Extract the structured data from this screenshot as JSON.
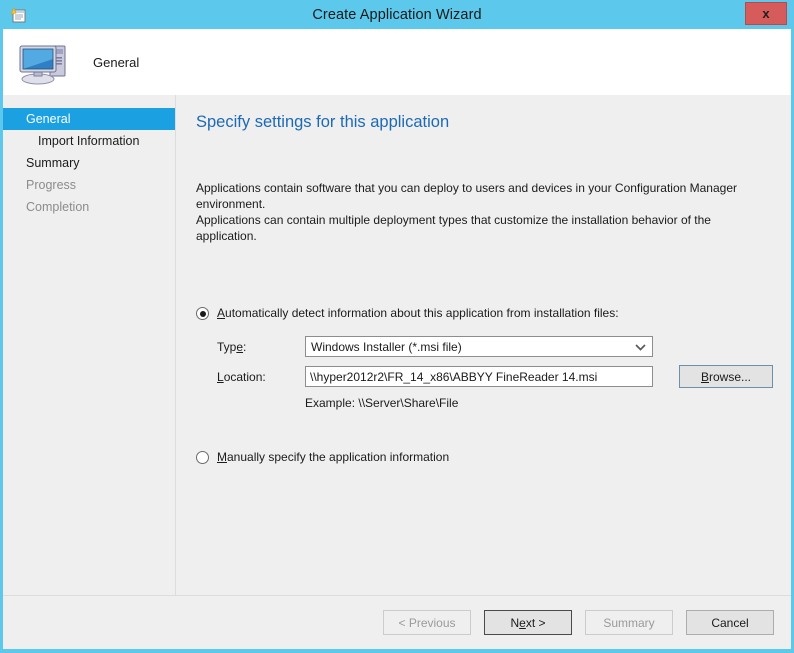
{
  "window": {
    "title": "Create Application Wizard",
    "title_icon": "wizard-document-icon",
    "close_label": "x"
  },
  "header": {
    "icon": "computer-icon",
    "label": "General"
  },
  "sidebar": {
    "items": [
      {
        "label": "General",
        "state": "selected",
        "indent": false
      },
      {
        "label": "Import Information",
        "state": "normal",
        "indent": true
      },
      {
        "label": "Summary",
        "state": "normal",
        "indent": false
      },
      {
        "label": "Progress",
        "state": "disabled",
        "indent": false
      },
      {
        "label": "Completion",
        "state": "disabled",
        "indent": false
      }
    ]
  },
  "content": {
    "page_title": "Specify settings for this application",
    "description_line1": "Applications contain software that you can deploy to users and devices in your Configuration Manager environment.",
    "description_line2": "Applications can contain multiple deployment types that customize the installation behavior of the application.",
    "option_auto": {
      "accesskey": "A",
      "rest": "utomatically detect information about this application from installation files:",
      "checked": true
    },
    "option_manual": {
      "accesskey": "M",
      "rest": "anually specify the application information",
      "checked": false
    },
    "type_field": {
      "label_pre": "Typ",
      "label_key": "e",
      "label_post": ":",
      "value": "Windows Installer (*.msi file)",
      "arrow_icon": "chevron-down-icon"
    },
    "location_field": {
      "label_key": "L",
      "label_rest": "ocation:",
      "value": "\\\\hyper2012r2\\FR_14_x86\\ABBYY FineReader 14.msi",
      "placeholder": ""
    },
    "browse_button": {
      "accesskey": "B",
      "rest": "rowse..."
    },
    "example_text": "Example: \\\\Server\\Share\\File"
  },
  "footer": {
    "previous": {
      "label": "< Previous",
      "disabled": true
    },
    "next": {
      "pre": "N",
      "key": "e",
      "post": "xt >",
      "disabled": false
    },
    "summary": {
      "label": "Summary",
      "disabled": true
    },
    "cancel": {
      "label": "Cancel",
      "disabled": false
    }
  },
  "colors": {
    "titlebar": "#5bc8ec",
    "accent_selected": "#1ba1e2",
    "heading": "#1c6ab5",
    "close_button": "#d65c5c",
    "panel": "#efeff0"
  }
}
